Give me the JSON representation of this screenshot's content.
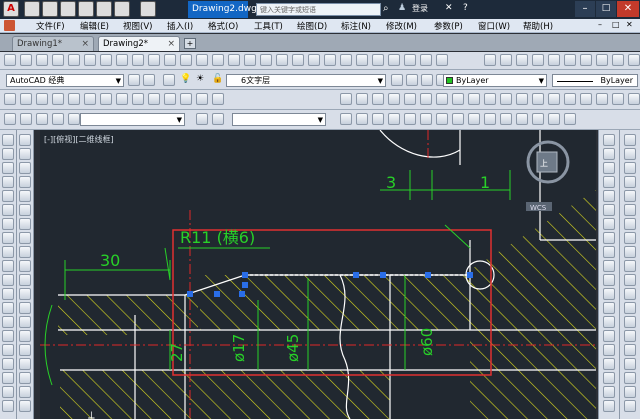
{
  "titlebar": {
    "document_title": "Drawing2.dwg",
    "search_placeholder": "键入关键字或短语",
    "login_label": "登录"
  },
  "menu": [
    "文件(F)",
    "编辑(E)",
    "视图(V)",
    "插入(I)",
    "格式(O)",
    "工具(T)",
    "绘图(D)",
    "标注(N)",
    "修改(M)",
    "参数(P)",
    "窗口(W)",
    "帮助(H)"
  ],
  "tabs": [
    {
      "label": "Drawing1*"
    },
    {
      "label": "Drawing2*"
    }
  ],
  "workspace": {
    "workspace_select": "AutoCAD 经典",
    "layer_select": "6文字层",
    "color_select": "ByLayer",
    "linetype_select": "ByLayer"
  },
  "viewport": {
    "label": "[-][俯视][二维线框]",
    "compass_label": "WCS"
  },
  "drawing_text": {
    "r11": "R11 (横6)",
    "dim30": "30",
    "dim3": "3",
    "dim1": "1",
    "d17": "ø17",
    "d45": "ø45",
    "d60": "ø60",
    "d27": "27"
  },
  "colors": {
    "selection_frame": "#e03030",
    "dimension": "#28d028",
    "hatch": "#e0e020",
    "outline": "#ffffff",
    "grip": "#2a6ee8",
    "centerline": "#e02828"
  }
}
